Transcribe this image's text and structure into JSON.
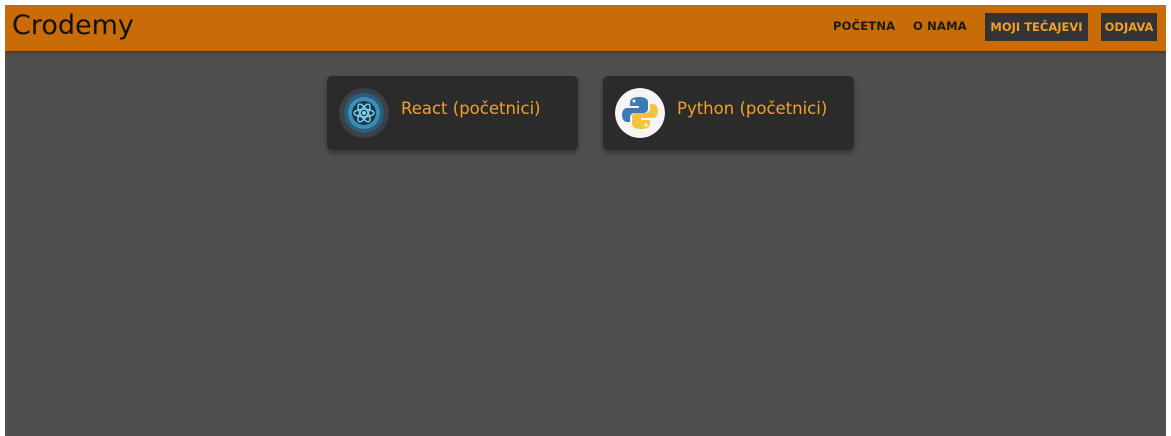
{
  "brand": "Crodemy",
  "nav": {
    "links": [
      "POČETNA",
      "O NAMA"
    ],
    "my_courses": "MOJI TEČAJEVI",
    "logout": "ODJAVA"
  },
  "courses": [
    {
      "title": "React (početnici)",
      "icon": "react-icon"
    },
    {
      "title": "Python (početnici)",
      "icon": "python-icon"
    }
  ],
  "colors": {
    "navbar": "#c96b06",
    "background": "#4f4f4f",
    "card": "#2b2b2b",
    "accent": "#f1a12a",
    "button_bg": "#333333"
  }
}
